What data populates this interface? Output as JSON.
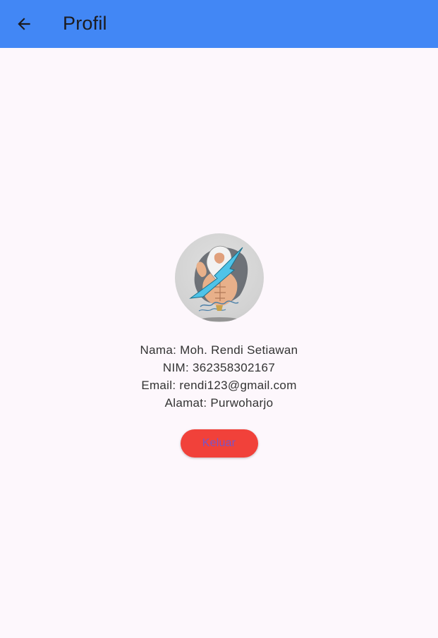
{
  "appbar": {
    "title": "Profil",
    "back_icon": "arrow-left-icon",
    "background": "#4287f5"
  },
  "profile": {
    "avatar_description": "zeus-illustration",
    "nama": "Nama: Moh. Rendi Setiawan",
    "nim": "NIM: 362358302167",
    "email": "Email: rendi123@gmail.com",
    "alamat": "Alamat: Purwoharjo"
  },
  "actions": {
    "logout_label": "Keluar",
    "logout_color": "#f1413a",
    "logout_text_color": "#7a54c7"
  }
}
